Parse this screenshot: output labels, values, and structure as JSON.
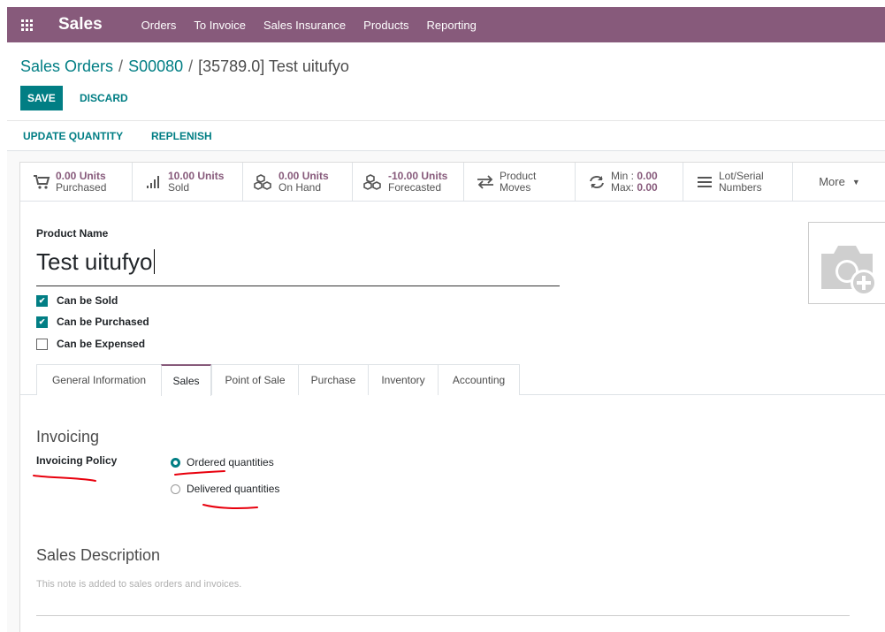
{
  "app": {
    "name": "Sales",
    "menu": [
      "Orders",
      "To Invoice",
      "Sales Insurance",
      "Products",
      "Reporting"
    ]
  },
  "breadcrumb": {
    "root": "Sales Orders",
    "order": "S00080",
    "current": "[35789.0] Test uitufyo"
  },
  "buttons": {
    "save": "SAVE",
    "discard": "DISCARD",
    "update_quantity": "UPDATE QUANTITY",
    "replenish": "REPLENISH"
  },
  "stat_buttons": {
    "purchased": {
      "value": "0.00 Units",
      "label": "Purchased"
    },
    "sold": {
      "value": "10.00 Units",
      "label": "Sold"
    },
    "on_hand": {
      "value": "0.00 Units",
      "label": "On Hand"
    },
    "forecasted": {
      "value": "-10.00 Units",
      "label": "Forecasted"
    },
    "moves": {
      "line1": "Product",
      "line2": "Moves"
    },
    "minmax": {
      "min_label": "Min :",
      "min_value": "0.00",
      "max_label": "Max:",
      "max_value": "0.00"
    },
    "lots": {
      "line1": "Lot/Serial",
      "line2": "Numbers"
    },
    "more": "More"
  },
  "product": {
    "name_label": "Product Name",
    "name": "Test uitufyo",
    "checkboxes": [
      {
        "label": "Can be Sold",
        "checked": true
      },
      {
        "label": "Can be Purchased",
        "checked": true
      },
      {
        "label": "Can be Expensed",
        "checked": false
      }
    ]
  },
  "tabs": [
    "General Information",
    "Sales",
    "Point of Sale",
    "Purchase",
    "Inventory",
    "Accounting"
  ],
  "active_tab": "Sales",
  "invoicing": {
    "title": "Invoicing",
    "policy_label": "Invoicing Policy",
    "options": [
      {
        "label": "Ordered quantities",
        "selected": true
      },
      {
        "label": "Delivered quantities",
        "selected": false
      }
    ]
  },
  "sales_description": {
    "title": "Sales Description",
    "placeholder": "This note is added to sales orders and invoices."
  },
  "colors": {
    "brand": "#875a7b",
    "accent": "#017e84",
    "annotation": "#e8000d"
  }
}
